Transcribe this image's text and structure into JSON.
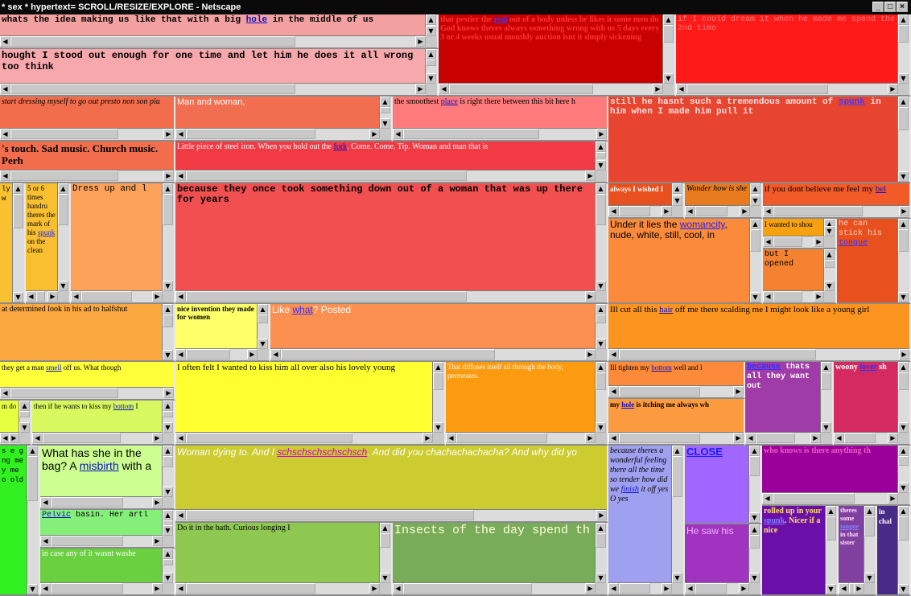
{
  "window": {
    "title": "* sex * hypertext= SCROLL/RESIZE/EXPLORE - Netscape",
    "buttons": [
      "_",
      "□",
      "×"
    ]
  },
  "frames": {
    "f1": {
      "pre": "whats the idea making us like that with a big ",
      "link": "hole",
      "post": " in the middle of us"
    },
    "f2": {
      "text": "hought I stood out enough for one time and let him he does it all wrong too think"
    },
    "f3": {
      "pre": "that pestier the ",
      "link": "real",
      "post": " out of a body unless he likes it some men do God knows theres always something wrong with us 5 days every 3 or 4 weeks usual monthly auction isnt it simply sickening"
    },
    "f4": {
      "text": "if I could dream it when he made me spend the 2nd time"
    },
    "f5": {
      "text": "start dressing myself to go out presto non son piu"
    },
    "f6": {
      "text": "Man and woman,"
    },
    "f7": {
      "pre": "the smoothest ",
      "link": "place",
      "post": " is right there between this bit here h"
    },
    "f8": {
      "pre": "still he hasnt such a tremendous amount of ",
      "link": "spunk",
      "post": " in him when I made him pull it"
    },
    "f9": {
      "text": "'s touch. Sad music. Church music. Perh"
    },
    "f10": {
      "pre": "Little piece of steel iron. When you hold out the ",
      "link": "fork",
      "post": ". Come. Come. Tip. Woman and man that is"
    },
    "f11": {
      "text": "ly w"
    },
    "f12": {
      "pre": "5 or 6 times handru theres the mark of his ",
      "link": "spunk",
      "post": " on the clean"
    },
    "f13": {
      "text": "Dress up and l"
    },
    "f14": {
      "text": "because they once took something down out of a woman that was up there for years"
    },
    "f15": {
      "text": "always I wished I"
    },
    "f16": {
      "text": "Wonder how is she"
    },
    "f17": {
      "pre": "if you dont believe me feel my ",
      "link": "bel"
    },
    "f18": {
      "pre": "Under it lies the ",
      "link": "womancity",
      "post": ", nude, white, still, cool, in"
    },
    "f19": {
      "text": "I wanted to shou"
    },
    "f20": {
      "text": "but I opened"
    },
    "f21": {
      "pre": "he can stick his ",
      "link": "tongue"
    },
    "f22": {
      "text": "at determined look in his ad to halfshut"
    },
    "f23": {
      "text": "nice invention they made for women"
    },
    "f24": {
      "pre": "Like ",
      "link": "what",
      "post": "? Posted"
    },
    "f25": {
      "pre": "Ill cut all this ",
      "link": "hair",
      "post": " off me there scalding me I might look like a young girl"
    },
    "f26": {
      "pre": "they get a man ",
      "link": "smell",
      "post": " off us. What though"
    },
    "f27": {
      "text": "I often felt I wanted to kiss him all over also his lovely young"
    },
    "f28": {
      "text": "That diffuses itself all through the body, permeates."
    },
    "f29": {
      "pre": "Ill tighten my ",
      "link": "bottom",
      "post": " well and l"
    },
    "f30": {
      "link": "because",
      "post": " thats all they want out"
    },
    "f31": {
      "pre": "woony ",
      "link": "lover",
      "post": " sh"
    },
    "f32": {
      "text": "m do"
    },
    "f33": {
      "pre": "then if he wants to kiss my ",
      "link": "bottom",
      "post": " I"
    },
    "f34": {
      "pre": "my ",
      "link": "hole",
      "post": " is itching me always wh"
    },
    "f35": {
      "text": "s e g ng me y me o old"
    },
    "f36": {
      "pre": "What has she in the bag? A ",
      "link": "misbirth",
      "post": " with a"
    },
    "f37": {
      "pre": "Woman dying to. And I ",
      "link": "schschschschschsch",
      "post": ". And did you chachachachacha? And why did yo"
    },
    "f38": {
      "pre": "because theres a wonderful feeling there all the time so tender how did we ",
      "link": "finish",
      "post": " it off yes O yes"
    },
    "f39": {
      "link": "CLOSE"
    },
    "f40": {
      "text": "who knows is there anything th"
    },
    "f41": {
      "link": "Pelvic",
      "post": " basin. Her artl"
    },
    "f42": {
      "text": "in case any of it wasnt washe"
    },
    "f43": {
      "text": "Do it in the bath. Curious longing I"
    },
    "f44": {
      "text": "Insects of the day spend th"
    },
    "f45": {
      "text": "He saw his"
    },
    "f46": {
      "pre": "rolled up in your ",
      "link": "spunk",
      "post": ". Nicer if a nice"
    },
    "f47": {
      "pre": "theres some ",
      "link": "tongue",
      "post": " in that sister"
    },
    "f48": {
      "text": "in chal"
    }
  }
}
